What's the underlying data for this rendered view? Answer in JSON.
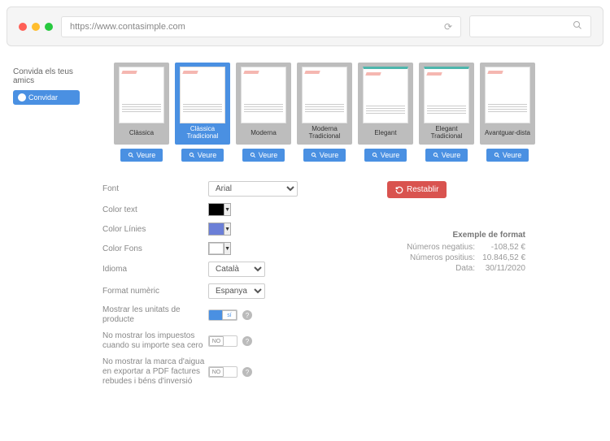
{
  "browser": {
    "url": "https://www.contasimple.com"
  },
  "sidebar": {
    "invite_text": "Convida els teus amics",
    "invite_button": "Convidar"
  },
  "templates": {
    "view_label": "Veure",
    "items": [
      {
        "label": "Clàssica",
        "selected": false
      },
      {
        "label": "Clàssica Tradicional",
        "selected": true
      },
      {
        "label": "Moderna",
        "selected": false
      },
      {
        "label": "Moderna Tradicional",
        "selected": false
      },
      {
        "label": "Elegant",
        "selected": false
      },
      {
        "label": "Elegant Tradicional",
        "selected": false
      },
      {
        "label": "Avantguar-dista",
        "selected": false
      }
    ]
  },
  "settings": {
    "font_label": "Font",
    "font_value": "Arial",
    "color_text_label": "Color text",
    "color_text_value": "#000000",
    "color_lines_label": "Color Línies",
    "color_lines_value": "#6b7fd7",
    "color_bg_label": "Color Fons",
    "color_bg_value": "#ffffff",
    "language_label": "Idioma",
    "language_value": "Català",
    "numformat_label": "Format numèric",
    "numformat_value": "Espanya",
    "toggle_units_label": "Mostrar les unitats de producte",
    "toggle_units_on": "sí",
    "toggle_taxes_label": "No mostrar los impuestos cuando su importe sea cero",
    "toggle_taxes_off": "NO",
    "toggle_watermark_label": "No mostrar la marca d'aigua en exportar a PDF factures rebudes i béns d'inversió",
    "toggle_watermark_off": "NO",
    "reset_button": "Restablir",
    "example_title": "Exemple de format",
    "example_neg_label": "Números negatius:",
    "example_neg_value": "-108,52 €",
    "example_pos_label": "Números positius:",
    "example_pos_value": "10.846,52 €",
    "example_date_label": "Data:",
    "example_date_value": "30/11/2020"
  }
}
